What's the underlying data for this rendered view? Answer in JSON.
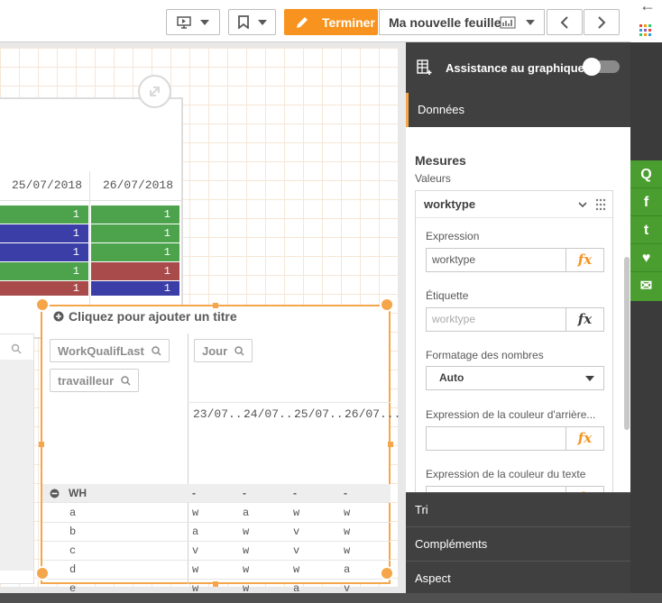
{
  "toolbar": {
    "done_label": "Terminer",
    "sheet_name": "Ma nouvelle feuille"
  },
  "corner": {
    "back_glyph": "←"
  },
  "upper_table": {
    "headers": [
      "25/07/2018",
      "26/07/2018"
    ],
    "rows": [
      {
        "a": "1",
        "b": "1"
      },
      {
        "a": "1",
        "b": "1"
      },
      {
        "a": "1",
        "b": "1"
      },
      {
        "a": "1",
        "b": "1"
      },
      {
        "a": "1",
        "b": "1"
      }
    ],
    "colors": {
      "green": "#4ca34c",
      "blue": "#3b3ea6",
      "red": "#a94b4b"
    }
  },
  "pivot": {
    "title": "Cliquez pour ajouter un titre",
    "row_fields": [
      "WorkQualifLast",
      "travailleur"
    ],
    "col_field": "Jour",
    "col_headers": [
      "23/07...",
      "24/07...",
      "25/07...",
      "26/07..."
    ],
    "group_label": "WH",
    "group_values": [
      "-",
      "-",
      "-",
      "-"
    ],
    "rows": [
      {
        "label": "a",
        "values": [
          "w",
          "a",
          "w",
          "w"
        ]
      },
      {
        "label": "b",
        "values": [
          "a",
          "w",
          "v",
          "w"
        ]
      },
      {
        "label": "c",
        "values": [
          "v",
          "w",
          "v",
          "w"
        ]
      },
      {
        "label": "d",
        "values": [
          "w",
          "w",
          "w",
          "a"
        ]
      },
      {
        "label": "e",
        "values": [
          "w",
          "w",
          "a",
          "v"
        ]
      }
    ]
  },
  "panel": {
    "assist_label": "Assistance au graphique",
    "tab_data": "Données",
    "section_title": "Mesures",
    "section_sub": "Valeurs",
    "measure_name": "worktype",
    "expression_label": "Expression",
    "expression_value": "worktype",
    "label_label": "Étiquette",
    "label_placeholder": "worktype",
    "format_label": "Formatage des nombres",
    "format_value": "Auto",
    "bgcolor_label": "Expression de la couleur d'arrière...",
    "textcolor_label": "Expression de la couleur du texte",
    "tab_sort": "Tri",
    "tab_addons": "Compléments",
    "tab_appearance": "Aspect"
  },
  "accent_color": "#f7931e",
  "social": [
    "Q",
    "f",
    "t",
    "♥",
    "✉"
  ]
}
